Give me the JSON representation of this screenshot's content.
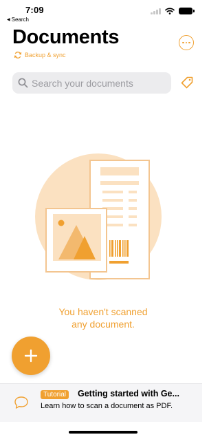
{
  "status_bar": {
    "time": "7:09",
    "back_label": "Search"
  },
  "header": {
    "title": "Documents",
    "sync_label": "Backup & sync"
  },
  "search": {
    "placeholder": "Search your documents"
  },
  "empty_state": {
    "line1": "You haven't scanned",
    "line2": "any document."
  },
  "tutorial": {
    "badge": "Tutorial",
    "title": "Getting started with Ge...",
    "description": "Learn how to scan a document as PDF."
  },
  "colors": {
    "accent": "#f0a030",
    "illustration_bg": "#fbe1c1",
    "search_bg": "#ececee"
  },
  "icons": [
    "wifi-icon",
    "battery-icon",
    "sync-icon",
    "more-icon",
    "search-icon",
    "tag-icon",
    "add-icon",
    "chat-icon"
  ]
}
